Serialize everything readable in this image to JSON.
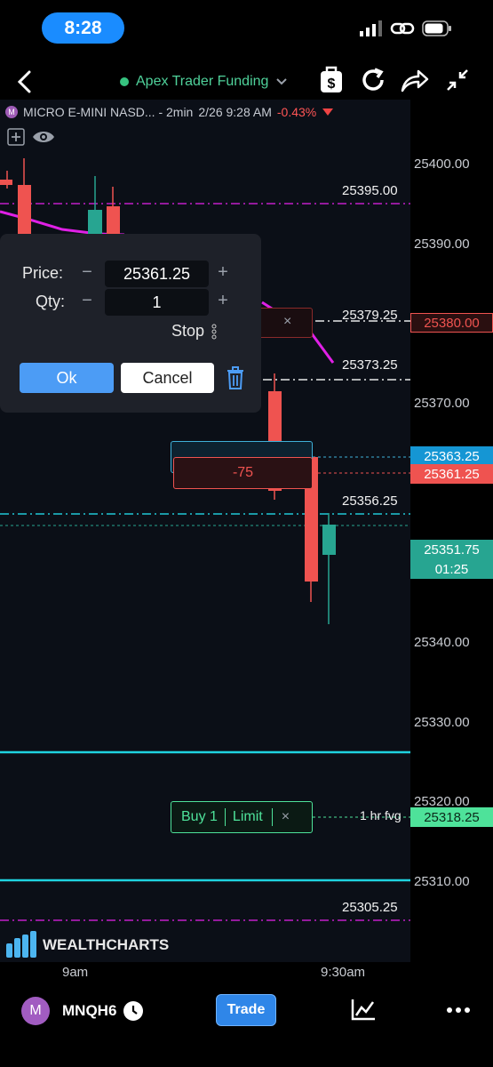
{
  "status_bar": {
    "time": "8:28"
  },
  "header": {
    "account_name": "Apex Trader Funding",
    "icons": [
      "back-icon",
      "chevron-down-icon",
      "dollar-bag-icon",
      "refresh-icon",
      "share-icon",
      "collapse-icon"
    ]
  },
  "chart": {
    "title": "MICRO E-MINI NASD... - 2min",
    "datetime": "2/26 9:28 AM",
    "change": "-0.43%",
    "symbol_badge": "M",
    "price_ticks": [
      "25400.00",
      "25390.00",
      "25370.00",
      "25340.00",
      "25330.00",
      "25320.00",
      "25310.00"
    ],
    "line_labels": {
      "l25395": "25395.00",
      "l25379": "25379.25",
      "l25373": "25373.25",
      "l25356": "25356.25",
      "l25305": "25305.25",
      "hr_fvg": "1 hr fvg"
    },
    "price_tags": {
      "stop": "25380.00",
      "blue": "25363.25",
      "red": "25361.25",
      "last": "25351.75",
      "countdown": "01:25",
      "buy_limit": "25318.25"
    },
    "position_pnl": "-75",
    "buy_order": {
      "qty_label": "Buy 1",
      "type": "Limit"
    },
    "watermark": "WEALTHCHARTS",
    "x_labels": [
      "9am",
      "9:30am"
    ],
    "colors": {
      "up": "#27a591",
      "down": "#ef5350",
      "accent_magenta": "#d020d6",
      "cyan": "#1fd3e0"
    }
  },
  "order_dialog": {
    "price_label": "Price:",
    "price_value": "25361.25",
    "qty_label": "Qty:",
    "qty_value": "1",
    "order_type": "Stop",
    "ok_label": "Ok",
    "cancel_label": "Cancel"
  },
  "bottom_bar": {
    "symbol_avatar": "M",
    "symbol": "MNQH6",
    "trade_label": "Trade"
  }
}
